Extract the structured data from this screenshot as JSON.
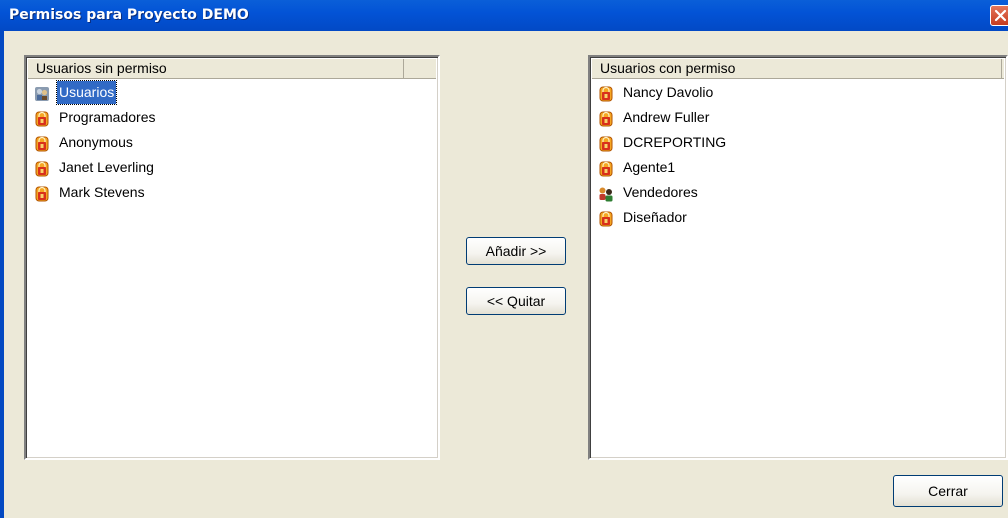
{
  "window": {
    "title": "Permisos para Proyecto DEMO"
  },
  "left_list": {
    "header": "Usuarios sin permiso",
    "items": [
      {
        "label": "Usuarios",
        "icon": "group-icon",
        "selected": true
      },
      {
        "label": "Programadores",
        "icon": "user-lock-icon",
        "selected": false
      },
      {
        "label": "Anonymous",
        "icon": "user-lock-icon",
        "selected": false
      },
      {
        "label": "Janet Leverling",
        "icon": "user-lock-icon",
        "selected": false
      },
      {
        "label": "Mark Stevens",
        "icon": "user-lock-icon",
        "selected": false
      }
    ]
  },
  "right_list": {
    "header": "Usuarios con permiso",
    "items": [
      {
        "label": "Nancy Davolio",
        "icon": "user-lock-icon"
      },
      {
        "label": "Andrew Fuller",
        "icon": "user-lock-icon"
      },
      {
        "label": "DCREPORTING",
        "icon": "user-lock-icon"
      },
      {
        "label": "Agente1",
        "icon": "user-lock-icon"
      },
      {
        "label": "Vendedores",
        "icon": "users-group-icon"
      },
      {
        "label": "Diseñador",
        "icon": "user-lock-icon"
      }
    ]
  },
  "buttons": {
    "add": "Añadir >>",
    "remove": "<< Quitar",
    "close": "Cerrar"
  },
  "colors": {
    "titlebar": "#0353d6",
    "selection": "#316ac5",
    "dialog_bg": "#ece9d8"
  }
}
